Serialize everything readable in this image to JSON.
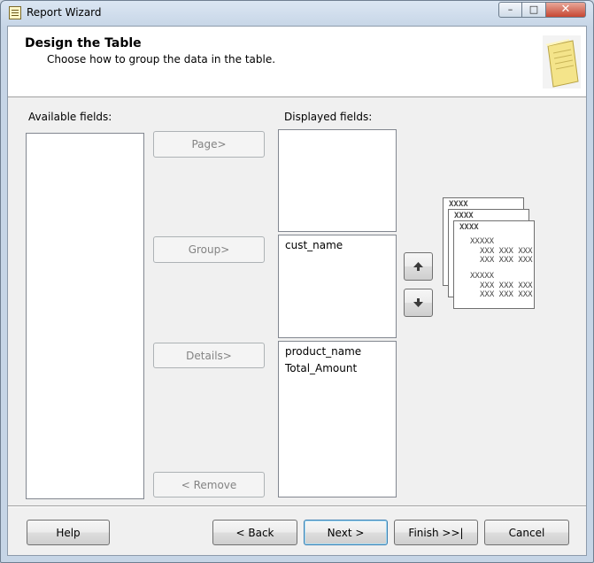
{
  "window": {
    "title": "Report Wizard",
    "controls": {
      "minimize": "–",
      "maximize": "□",
      "close": "✕"
    }
  },
  "header": {
    "title": "Design the Table",
    "subtitle": "Choose how to group the data in the table."
  },
  "labels": {
    "available_fields": "Available fields:",
    "displayed_fields": "Displayed fields:"
  },
  "lists": {
    "available": [],
    "page": [],
    "group": [
      "cust_name"
    ],
    "details": [
      "product_name",
      "Total_Amount"
    ]
  },
  "move_buttons": {
    "page": "Page>",
    "group": "Group>",
    "details": "Details>",
    "remove": "< Remove"
  },
  "preview": {
    "page_header": "XXXX",
    "group_header": "XXXXX",
    "detail_row": "XXX XXX XXX"
  },
  "footer": {
    "help": "Help",
    "back": "< Back",
    "next": "Next >",
    "finish": "Finish >>|",
    "cancel": "Cancel"
  },
  "icons": {
    "app": "report-wizard-icon",
    "header": "report-page-icon",
    "move_up": "arrow-up-icon",
    "move_down": "arrow-down-icon"
  }
}
